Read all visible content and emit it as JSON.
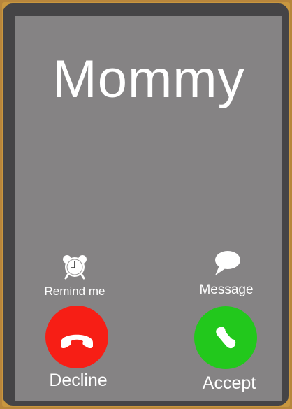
{
  "call": {
    "caller_name": "Mommy"
  },
  "actions": {
    "remind_me_label": "Remind me",
    "message_label": "Message",
    "decline_label": "Decline",
    "accept_label": "Accept"
  },
  "icons": {
    "remind": "alarm-clock-icon",
    "message": "speech-bubble-icon",
    "decline": "phone-hangup-icon",
    "accept": "phone-handset-icon"
  },
  "colors": {
    "screen_background": "#858384",
    "decline": "#f71e15",
    "accept": "#22c81c",
    "bezel": "#454446",
    "frame": "#c9973f"
  }
}
